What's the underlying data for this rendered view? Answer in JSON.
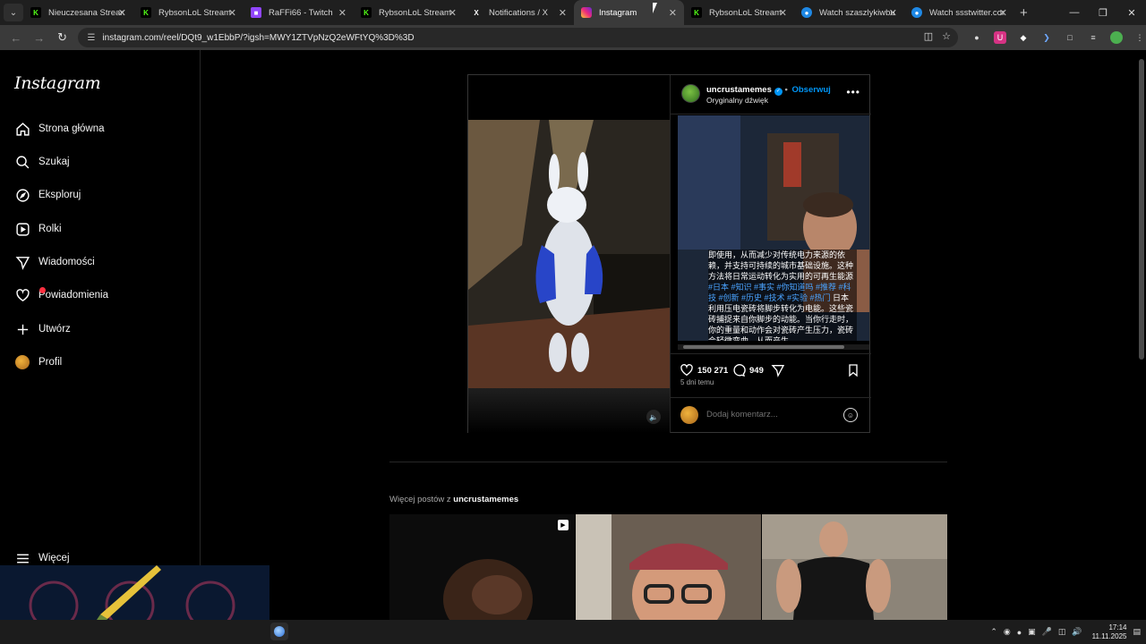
{
  "browser": {
    "tabs": [
      {
        "label": "Nieuczesana Stream",
        "icon": "kick-icon",
        "active": false
      },
      {
        "label": "RybsonLoL Stream - …",
        "icon": "kick-icon",
        "active": false
      },
      {
        "label": "RaFFi66 - Twitch",
        "icon": "twitch-icon",
        "active": false
      },
      {
        "label": "RybsonLoL Stream - …",
        "icon": "kick-icon",
        "active": false
      },
      {
        "label": "Notifications / X",
        "icon": "x-icon",
        "active": false
      },
      {
        "label": "Instagram",
        "icon": "instagram-icon",
        "active": true
      },
      {
        "label": "RybsonLoL Stream - …",
        "icon": "kick-icon",
        "active": false
      },
      {
        "label": "Watch szaszlykiwbuk",
        "icon": "globe-icon",
        "active": false
      },
      {
        "label": "Watch ssstwitter.com",
        "icon": "globe-icon",
        "active": false
      }
    ],
    "url": "instagram.com/reel/DQt9_w1EbbP/?igsh=MWY1ZTVpNzQ2eWFtYQ%3D%3D"
  },
  "sidebar": {
    "logo": "Instagram",
    "items": [
      {
        "label": "Strona główna",
        "icon": "home-icon"
      },
      {
        "label": "Szukaj",
        "icon": "search-icon"
      },
      {
        "label": "Eksploruj",
        "icon": "compass-icon"
      },
      {
        "label": "Rolki",
        "icon": "reels-icon"
      },
      {
        "label": "Wiadomości",
        "icon": "messages-icon"
      },
      {
        "label": "Powiadomienia",
        "icon": "heart-icon"
      },
      {
        "label": "Utwórz",
        "icon": "plus-icon"
      },
      {
        "label": "Profil",
        "icon": "profile-avatar"
      }
    ],
    "more": "Więcej"
  },
  "post": {
    "username": "uncrustamemes",
    "follow": "Obserwuj",
    "audio": "Oryginalny dźwięk",
    "caption_text": "即使用，从而减少对传统电力来源的依赖，并支持可持续的城市基础设施。这种方法将日常运动转化为实用的可再生能源",
    "caption_tags": " #日本 #知识 #事实 #你知道吗 #推荐 #科技 #创新 #历史 #技术 #实验 #热门",
    "caption_tail": " 日本利用压电瓷砖将脚步转化为电能。这些瓷砖捕捉来自你脚步的动能。当你行走时，你的重量和动作会对瓷砖产生压力，瓷砖会轻微弯曲，从而产生",
    "likes": "150 271",
    "comments": "949",
    "time": "5 dni temu",
    "comment_placeholder": "Dodaj komentarz..."
  },
  "more_posts": {
    "prefix": "Więcej postów z ",
    "user": "uncrustamemes"
  },
  "taskbar": {
    "time": "17:14",
    "date": "11.11.2025"
  }
}
